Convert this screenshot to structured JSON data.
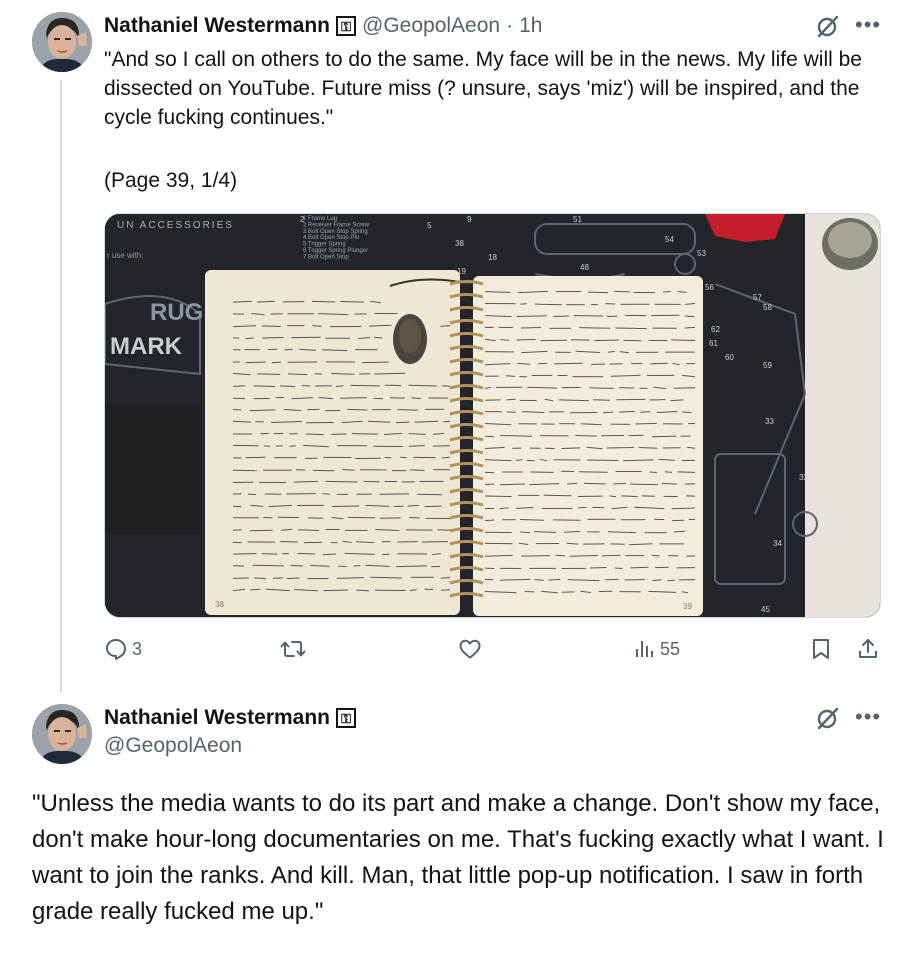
{
  "tweet1": {
    "author": {
      "display_name": "Nathaniel Westermann",
      "badge": "⚿",
      "handle": "@GeopolAeon",
      "separator": "·",
      "time": "1h"
    },
    "text": "\"And so I call on others to do the same. My face will be in the news. My life will be dissected on YouTube. Future miss (? unsure, says 'miz') will be inspired, and the cycle fucking continues.\"",
    "page_note": "(Page 39, 1/4)",
    "media": {
      "description_labels": {
        "banner_top": "UN ACCESSORIES",
        "use_with": "r use with:",
        "brand_line1": "RUG",
        "brand_line2": "MARK"
      },
      "parts_list": [
        "Frame Lug",
        "Receiver Frame Screw",
        "Bolt Open Stop Spring",
        "Bolt Open Stop Pin",
        "Trigger Spring",
        "Trigger Spring Plunger",
        "Bolt Open Stop"
      ],
      "part_numbers": [
        "51",
        "54",
        "53",
        "56",
        "57",
        "58",
        "62",
        "61",
        "60",
        "59",
        "33",
        "32",
        "34",
        "45",
        "48",
        "18",
        "19",
        "38",
        "9",
        "5",
        "2"
      ],
      "page_numbers": [
        "38",
        "39"
      ]
    },
    "actions": {
      "replies": "3",
      "retweets": "",
      "likes": "",
      "views": "55"
    }
  },
  "tweet2": {
    "author": {
      "display_name": "Nathaniel Westermann",
      "badge": "⚿",
      "handle": "@GeopolAeon"
    },
    "text": "\"Unless the media wants to do its part and make a change. Don't show my face, don't make hour-long documentaries on me. That's fucking exactly what I want. I want to join the ranks. And kill. Man, that little pop-up notification. I saw in forth grade really fucked me up.\""
  },
  "icons": {
    "more": "more-icon",
    "grok": "slashed-circle-icon",
    "reply": "reply-icon",
    "retweet": "retweet-icon",
    "like": "heart-icon",
    "views": "views-icon",
    "bookmark": "bookmark-icon",
    "share": "share-icon"
  },
  "colors": {
    "text_primary": "#0f1419",
    "text_secondary": "#536471",
    "thread_line": "#cfd9de"
  }
}
